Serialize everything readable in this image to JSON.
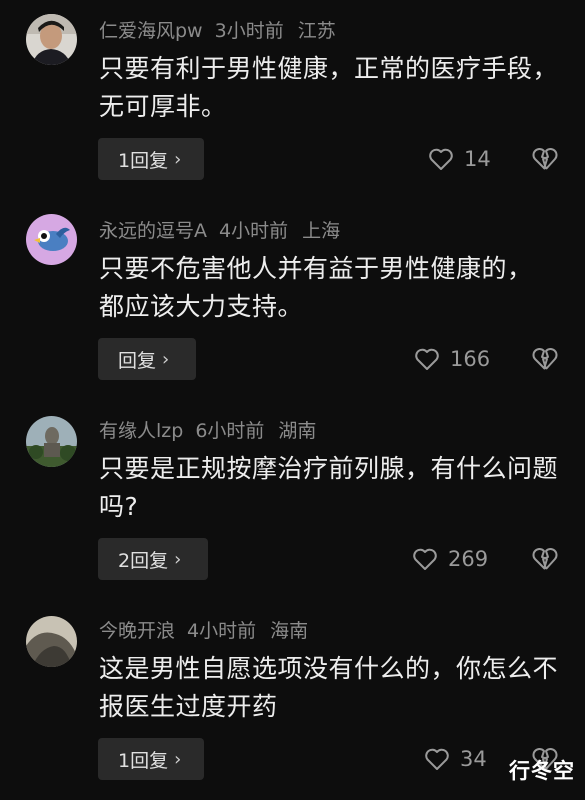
{
  "comments": [
    {
      "username": "仁爱海风pw",
      "time": "3小时前",
      "location": "江苏",
      "text": "只要有利于男性健康，正常的医疗手段，无可厚非。",
      "reply_label": "1回复",
      "likes": "14",
      "avatar": "photo-avatar-man"
    },
    {
      "username": "永远的逗号A",
      "time": "4小时前",
      "location": "上海",
      "text": "只要不危害他人并有益于男性健康的，都应该大力支持。",
      "reply_label": "回复",
      "likes": "166",
      "avatar": "cartoon-bird-avatar"
    },
    {
      "username": "有缘人lzp",
      "time": "6小时前",
      "location": "湖南",
      "text": "只要是正规按摩治疗前列腺，有什么问题吗?",
      "reply_label": "2回复",
      "likes": "269",
      "avatar": "statue-photo-avatar"
    },
    {
      "username": "今晚开浪",
      "time": "4小时前",
      "location": "海南",
      "text": "这是男性自愿选项没有什么的，你怎么不报医生过度开药",
      "reply_label": "1回复",
      "likes": "34",
      "avatar": "rock-photo-avatar"
    }
  ],
  "icons": {
    "like": "heart-outline-icon",
    "dislike": "broken-heart-icon",
    "chevron": "chevron-right-icon"
  },
  "watermark": "行冬空"
}
